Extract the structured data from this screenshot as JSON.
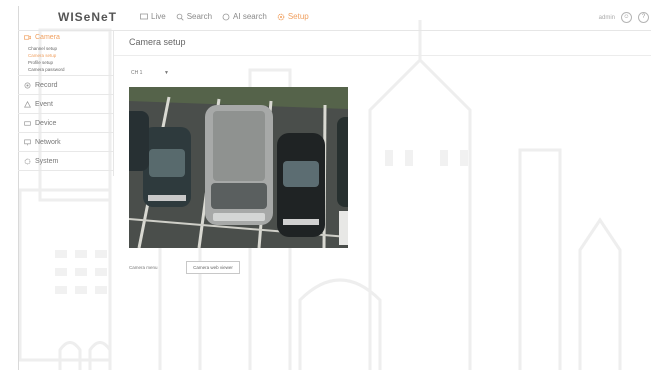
{
  "brand": {
    "logo": "WISeNeT"
  },
  "topnav": [
    {
      "label": "Live",
      "icon": "monitor-icon",
      "active": false
    },
    {
      "label": "Search",
      "icon": "search-icon",
      "active": false
    },
    {
      "label": "AI search",
      "icon": "ai-search-icon",
      "active": false
    },
    {
      "label": "Setup",
      "icon": "gear-icon",
      "active": true
    }
  ],
  "topright": {
    "user_text": "admin",
    "icons": [
      "user-icon",
      "help-icon"
    ]
  },
  "sidebar": {
    "camera": {
      "label": "Camera",
      "icon": "camera-icon",
      "items": [
        "Channel setup",
        "Camera setup",
        "Profile setup",
        "Camera password"
      ],
      "active_item": "Camera setup"
    },
    "sections": [
      {
        "label": "Record",
        "icon": "record-icon"
      },
      {
        "label": "Event",
        "icon": "event-icon"
      },
      {
        "label": "Device",
        "icon": "device-icon"
      },
      {
        "label": "Network",
        "icon": "network-icon"
      },
      {
        "label": "System",
        "icon": "system-icon"
      }
    ]
  },
  "main": {
    "title": "Camera setup",
    "channel_value": "CH 1",
    "camera_menu_label": "Camera menu",
    "camera_menu_button": "Camera web viewer"
  },
  "colors": {
    "accent": "#f0a060",
    "text": "#777777",
    "line": "#e6e6e6"
  }
}
